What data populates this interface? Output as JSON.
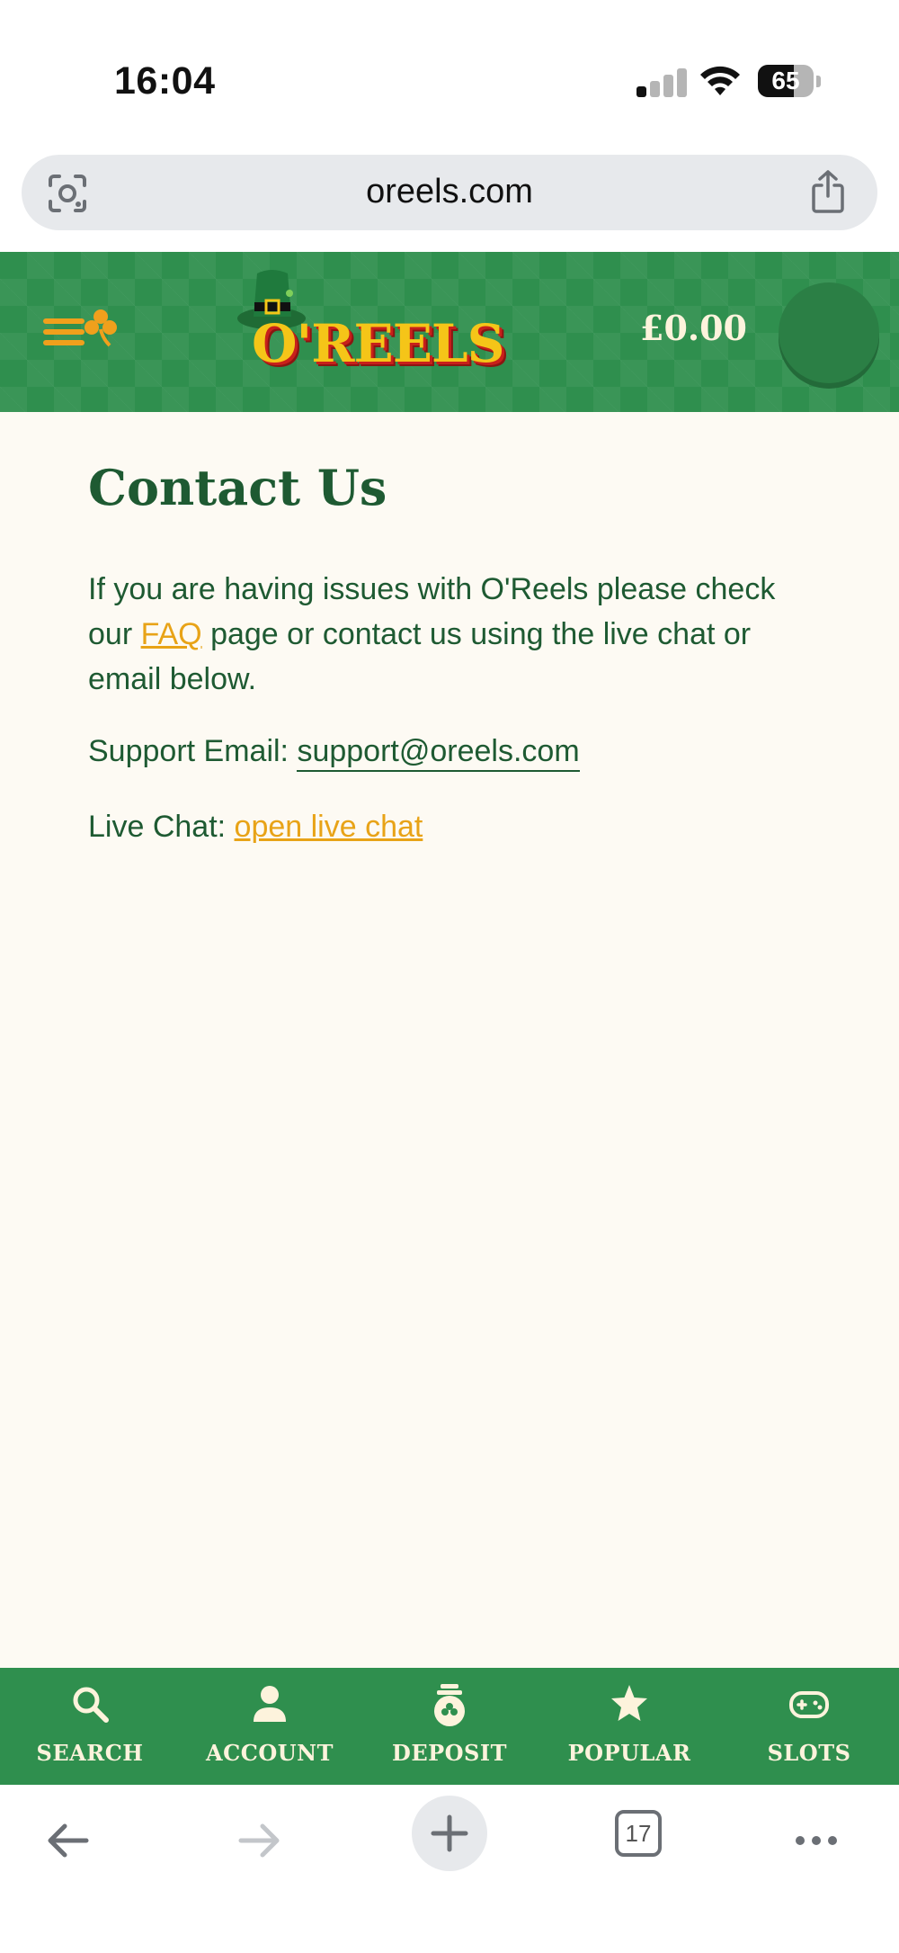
{
  "status_bar": {
    "time": "16:04",
    "battery": "65",
    "battery_level": 0.65
  },
  "browser": {
    "url": "oreels.com",
    "tab_count": "17"
  },
  "header": {
    "logo_text": "O'REELS",
    "balance": "£0.00"
  },
  "content": {
    "title": "Contact Us",
    "intro_before": "If you are having issues with O'Reels please check our ",
    "faq_link": "FAQ",
    "intro_after": " page or contact us using the live chat or email below.",
    "support_label": "Support Email: ",
    "support_email": "support@oreels.com",
    "chat_label": "Live Chat: ",
    "chat_link": "open live chat"
  },
  "bottom_nav": {
    "search": "SEARCH",
    "account": "ACCOUNT",
    "deposit": "DEPOSIT",
    "popular": "POPULAR",
    "slots": "SLOTS"
  },
  "colors": {
    "brand_green": "#2f8f4e",
    "heading_green": "#1e5a32",
    "accent_gold": "#e8a317",
    "page_bg": "#fdfaf3"
  }
}
